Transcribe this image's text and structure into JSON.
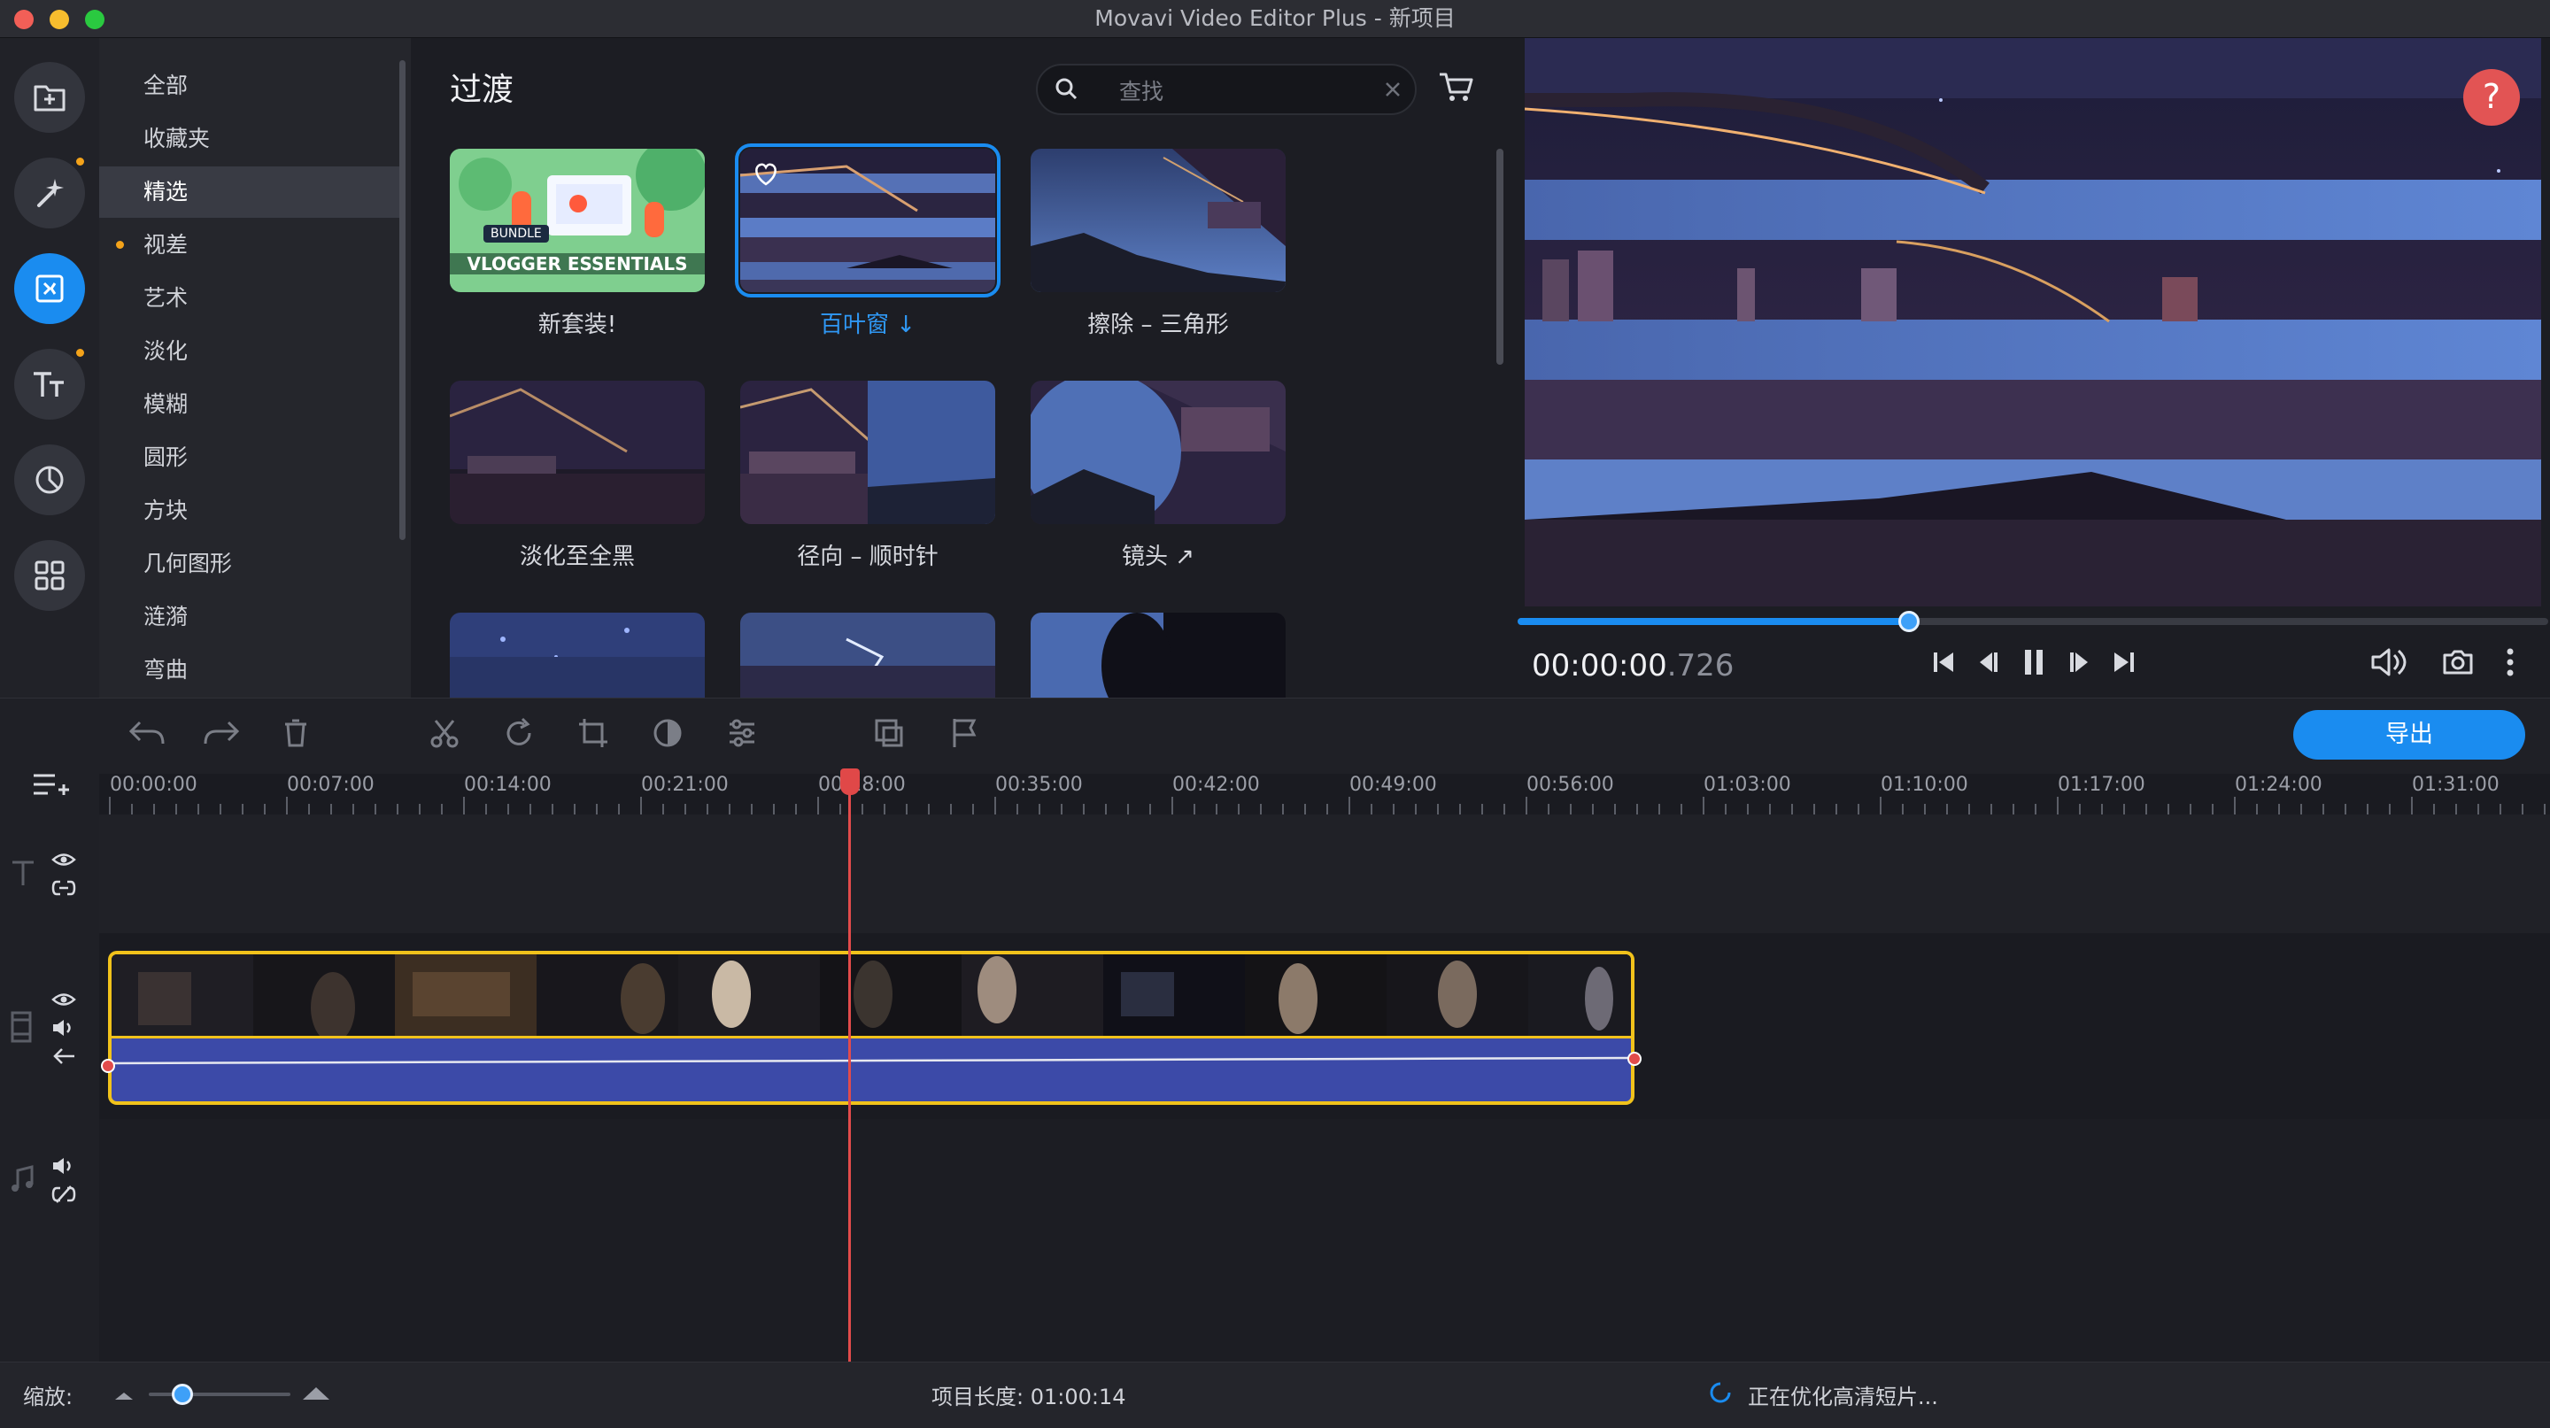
{
  "window": {
    "title": "Movavi Video Editor Plus - 新项目"
  },
  "colors": {
    "accent": "#1a8cf0",
    "clip_border": "#f1c21b",
    "playhead": "#e24b4b",
    "audio_fill": "#3c4aa8"
  },
  "left_toolbar": {
    "items": [
      {
        "name": "import",
        "icon": "import-icon"
      },
      {
        "name": "effects",
        "icon": "magic-wand-icon",
        "badge": true
      },
      {
        "name": "transitions",
        "icon": "transition-icon",
        "active": true
      },
      {
        "name": "titles",
        "icon": "titles-icon",
        "badge": true
      },
      {
        "name": "stickers",
        "icon": "sticker-icon"
      },
      {
        "name": "more",
        "icon": "grid-icon"
      }
    ]
  },
  "categories": {
    "items": [
      "全部",
      "收藏夹",
      "精选",
      "视差",
      "艺术",
      "淡化",
      "模糊",
      "圆形",
      "方块",
      "几何图形",
      "涟漪",
      "弯曲"
    ],
    "selected": "精选",
    "dotted": "视差"
  },
  "effects_panel": {
    "title": "过渡",
    "search_placeholder": "查找",
    "items": [
      {
        "label": "新套装!",
        "badge_top": "BUNDLE",
        "badge_main": "VLOGGER ESSENTIALS"
      },
      {
        "label": "百叶窗 ↓",
        "selected": true
      },
      {
        "label": "擦除 – 三角形"
      },
      {
        "label": "淡化至全黑"
      },
      {
        "label": "径向 – 顺时针"
      },
      {
        "label": "镜头 ↗"
      },
      {
        "label": ""
      },
      {
        "label": ""
      },
      {
        "label": ""
      }
    ]
  },
  "preview": {
    "progress": 0.38,
    "timecode_main": "00:00:00",
    "timecode_ms": ".726",
    "help_label": "?"
  },
  "timeline": {
    "export_label": "导出",
    "ruler": [
      "00:00:00",
      "00:07:00",
      "00:14:00",
      "00:21:00",
      "00:28:00",
      "00:35:00",
      "00:42:00",
      "00:49:00",
      "00:56:00",
      "01:03:00",
      "01:10:00",
      "01:17:00",
      "01:24:00",
      "01:31:00"
    ],
    "playhead_time": "00:28:00"
  },
  "status": {
    "zoom_label": "缩放:",
    "project_length": "项目长度:  01:00:14",
    "optimizing": "正在优化高清短片..."
  }
}
